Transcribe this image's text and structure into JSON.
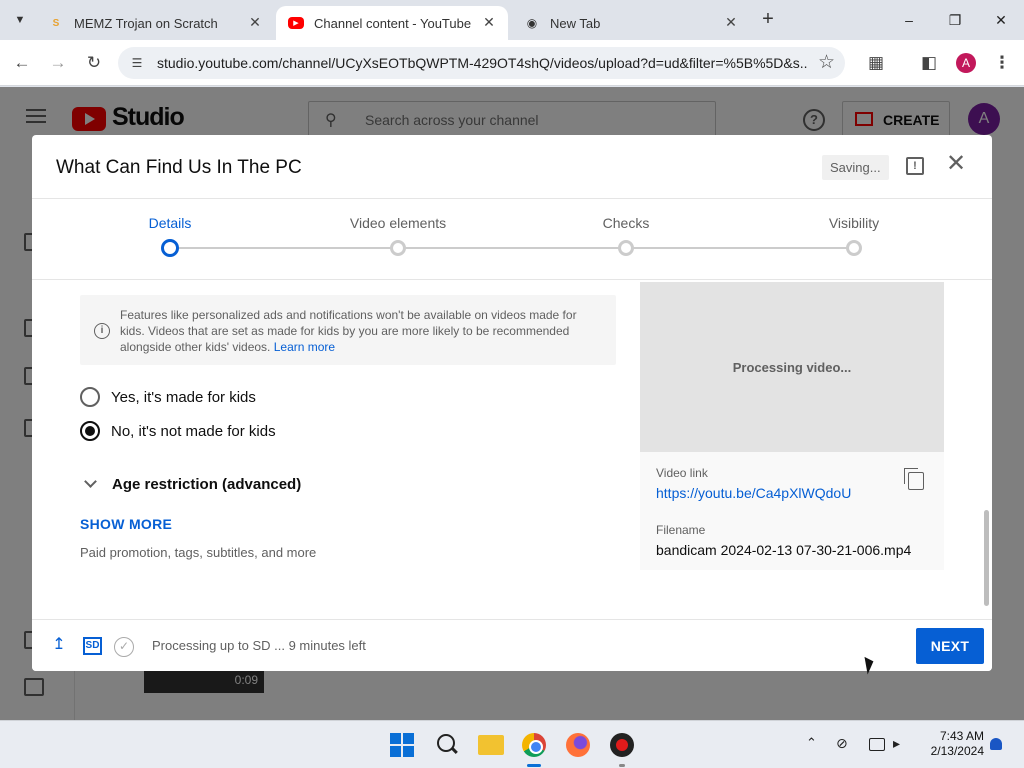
{
  "browser": {
    "tabs": [
      {
        "title": "MEMZ Trojan on Scratch",
        "icon": "scratch-favicon",
        "active": false
      },
      {
        "title": "Channel content - YouTube Studio",
        "icon": "youtube-favicon",
        "active": true
      },
      {
        "title": "New Tab",
        "icon": "chrome-newtab-favicon",
        "active": false
      }
    ],
    "url": "studio.youtube.com/channel/UCyXsEOTbQWPTM-429OT4shQ/videos/upload?d=ud&filter=%5B%5D&s...",
    "profile_initial": "A"
  },
  "studio": {
    "logo_text": "Studio",
    "search_placeholder": "Search across your channel",
    "create_label": "CREATE",
    "avatar_initial": "A",
    "thumbnail_duration": "0:09"
  },
  "modal": {
    "title": "What Can Find Us In The PC",
    "saving": "Saving...",
    "steps": [
      {
        "label": "Details",
        "active": true
      },
      {
        "label": "Video elements",
        "active": false
      },
      {
        "label": "Checks",
        "active": false
      },
      {
        "label": "Visibility",
        "active": false
      }
    ],
    "info_text": "Features like personalized ads and notifications won't be available on videos made for kids. Videos that are set as made for kids by you are more likely to be recommended alongside other kids' videos.",
    "info_link": "Learn more",
    "radio_options": [
      {
        "label": "Yes, it's made for kids",
        "checked": false
      },
      {
        "label": "No, it's not made for kids",
        "checked": true
      }
    ],
    "age_restriction": "Age restriction (advanced)",
    "show_more": "SHOW MORE",
    "show_more_sub": "Paid promotion, tags, subtitles, and more",
    "preview_status": "Processing video...",
    "video_link_label": "Video link",
    "video_link": "https://youtu.be/Ca4pXlWQdoU",
    "filename_label": "Filename",
    "filename": "bandicam 2024-02-13 07-30-21-006.mp4",
    "footer_sd": "SD",
    "footer_status": "Processing up to SD ... 9 minutes left",
    "next_label": "NEXT"
  },
  "taskbar": {
    "time": "7:43 AM",
    "date": "2/13/2024"
  },
  "colors": {
    "accent_blue": "#065fd4",
    "youtube_red": "#ff0000"
  }
}
